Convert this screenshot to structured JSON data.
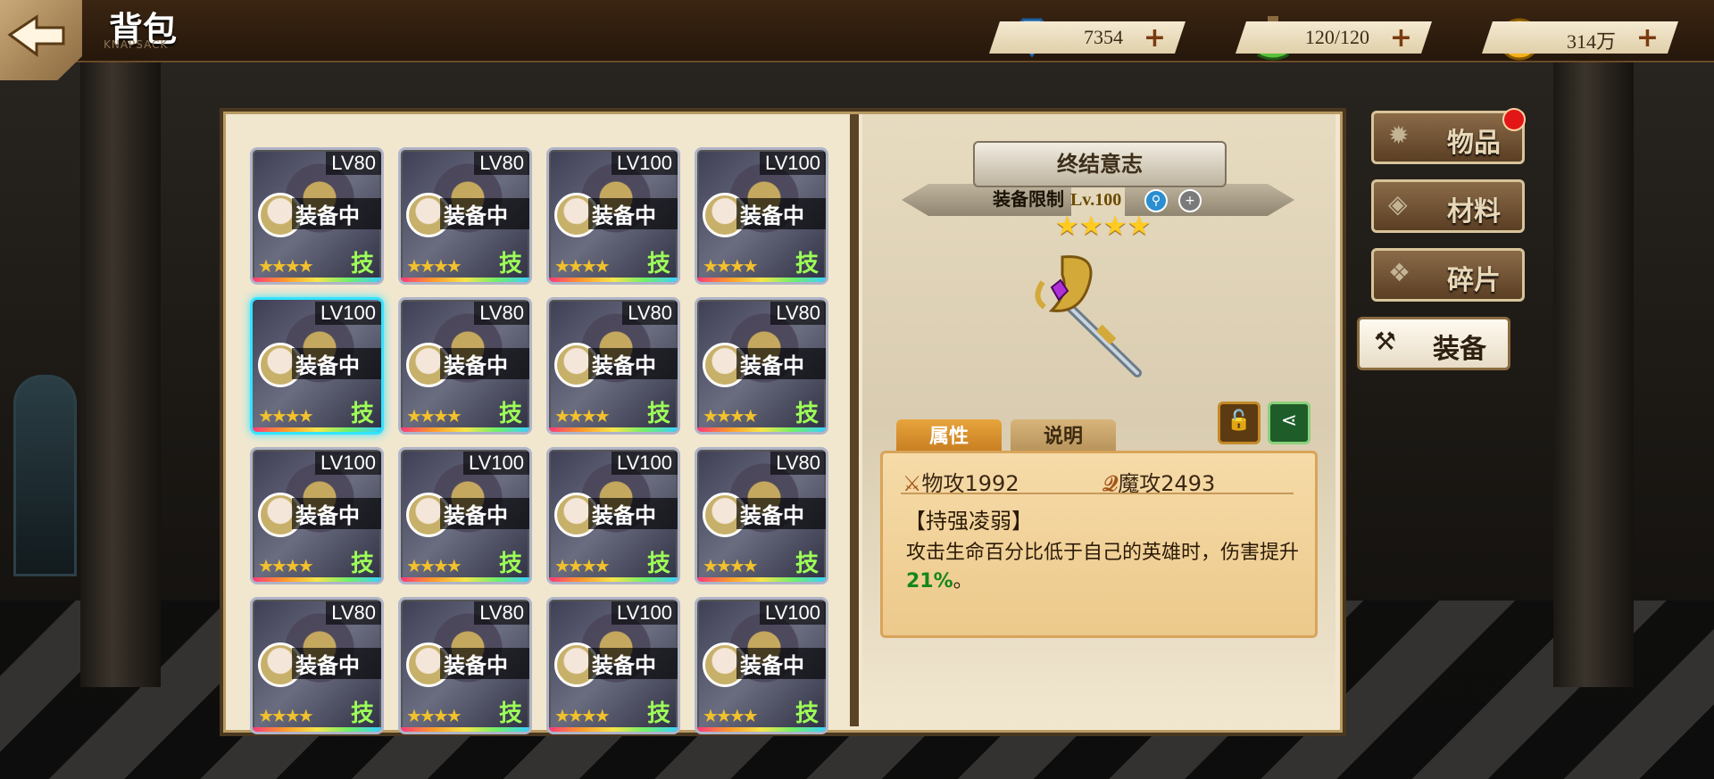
{
  "header": {
    "title": "背包",
    "subtitle": "KNAPSACK"
  },
  "currencies": [
    {
      "name": "diamond-icon",
      "value": "7354"
    },
    {
      "name": "stamina-potion-icon",
      "value": "120/120"
    },
    {
      "name": "gold-coin-icon",
      "value": "314万"
    }
  ],
  "items": [
    {
      "level": "LV80",
      "status": "装备中",
      "skill": "技"
    },
    {
      "level": "LV80",
      "status": "装备中",
      "skill": "技"
    },
    {
      "level": "LV100",
      "status": "装备中",
      "skill": "技"
    },
    {
      "level": "LV100",
      "status": "装备中",
      "skill": "技"
    },
    {
      "level": "LV100",
      "status": "装备中",
      "skill": "技"
    },
    {
      "level": "LV80",
      "status": "装备中",
      "skill": "技"
    },
    {
      "level": "LV80",
      "status": "装备中",
      "skill": "技"
    },
    {
      "level": "LV80",
      "status": "装备中",
      "skill": "技"
    },
    {
      "level": "LV100",
      "status": "装备中",
      "skill": "技"
    },
    {
      "level": "LV100",
      "status": "装备中",
      "skill": "技"
    },
    {
      "level": "LV100",
      "status": "装备中",
      "skill": "技"
    },
    {
      "level": "LV80",
      "status": "装备中",
      "skill": "技"
    },
    {
      "level": "LV80",
      "status": "装备中",
      "skill": "技"
    },
    {
      "level": "LV80",
      "status": "装备中",
      "skill": "技"
    },
    {
      "level": "LV100",
      "status": "装备中",
      "skill": "技"
    },
    {
      "level": "LV100",
      "status": "装备中",
      "skill": "技"
    }
  ],
  "selected_index": 4,
  "detail": {
    "name": "终结意志",
    "requirement_label": "装备限制",
    "requirement_level": "Lv.100",
    "stars": "★★★★",
    "tabs": [
      "属性",
      "说明"
    ],
    "active_tab": "属性",
    "phys_attack": "物攻1992",
    "magic_attack": "魔攻2493",
    "skill_name": "【持强凌弱】",
    "desc_main": "攻击生命百分比低于自己的英雄时，伤害提升",
    "desc_value": "21%",
    "desc_end": "。"
  },
  "side_tabs": [
    {
      "label": "物品",
      "icon": "star-burst-icon",
      "active": false,
      "badge": true
    },
    {
      "label": "材料",
      "icon": "crystal-icon",
      "active": false,
      "badge": false
    },
    {
      "label": "碎片",
      "icon": "puzzle-piece-icon",
      "active": false,
      "badge": false
    },
    {
      "label": "装备",
      "icon": "equipment-icon",
      "active": true,
      "badge": false
    }
  ],
  "colors": {
    "accent_selected": "#35e3ff",
    "highlight_green": "#15871a",
    "badge_red": "#e21616"
  }
}
